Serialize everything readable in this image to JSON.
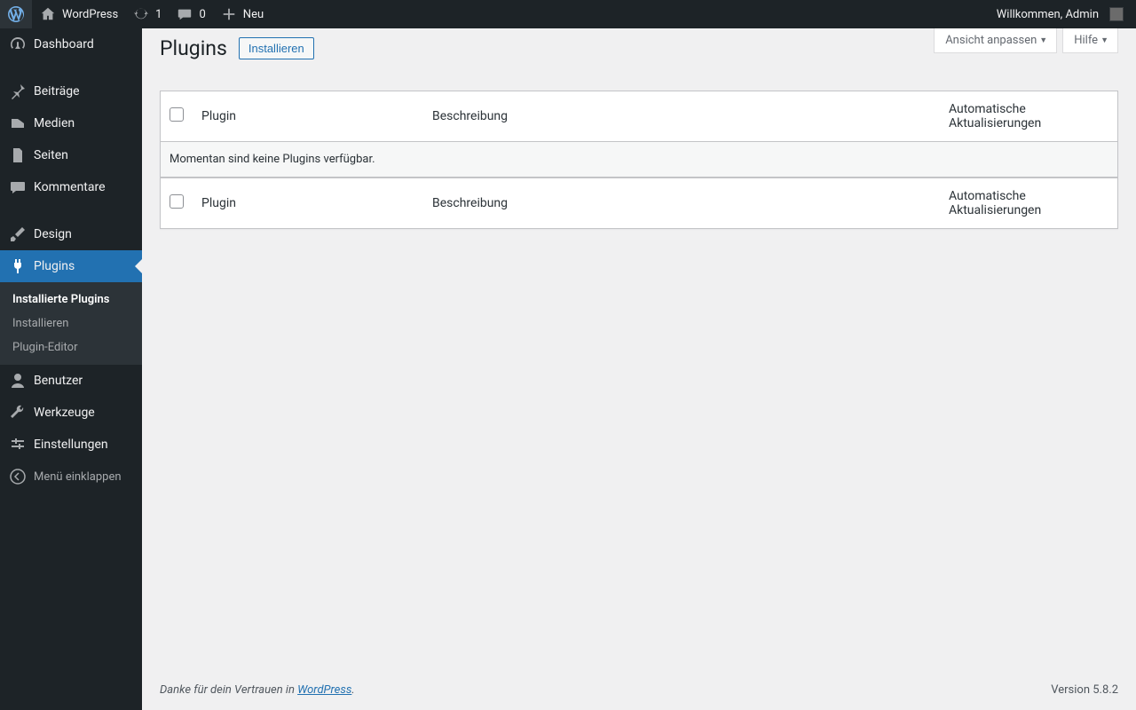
{
  "adminbar": {
    "site_name": "WordPress",
    "updates_count": "1",
    "comments_count": "0",
    "new_label": "Neu",
    "welcome": "Willkommen, Admin"
  },
  "sidebar": {
    "items": [
      {
        "label": "Dashboard"
      },
      {
        "label": "Beiträge"
      },
      {
        "label": "Medien"
      },
      {
        "label": "Seiten"
      },
      {
        "label": "Kommentare"
      },
      {
        "label": "Design"
      },
      {
        "label": "Plugins"
      },
      {
        "label": "Benutzer"
      },
      {
        "label": "Werkzeuge"
      },
      {
        "label": "Einstellungen"
      }
    ],
    "submenu_plugins": [
      {
        "label": "Installierte Plugins"
      },
      {
        "label": "Installieren"
      },
      {
        "label": "Plugin-Editor"
      }
    ],
    "collapse_label": "Menü einklappen"
  },
  "screen_meta": {
    "screen_options": "Ansicht anpassen",
    "help": "Hilfe"
  },
  "page": {
    "title": "Plugins",
    "action_button": "Installieren"
  },
  "table": {
    "col_plugin": "Plugin",
    "col_description": "Beschreibung",
    "col_updates": "Automatische Aktualisierungen",
    "empty_message": "Momentan sind keine Plugins verfügbar."
  },
  "footer": {
    "thanks_prefix": "Danke für dein Vertrauen in ",
    "thanks_link": "WordPress",
    "thanks_suffix": ".",
    "version": "Version 5.8.2"
  }
}
